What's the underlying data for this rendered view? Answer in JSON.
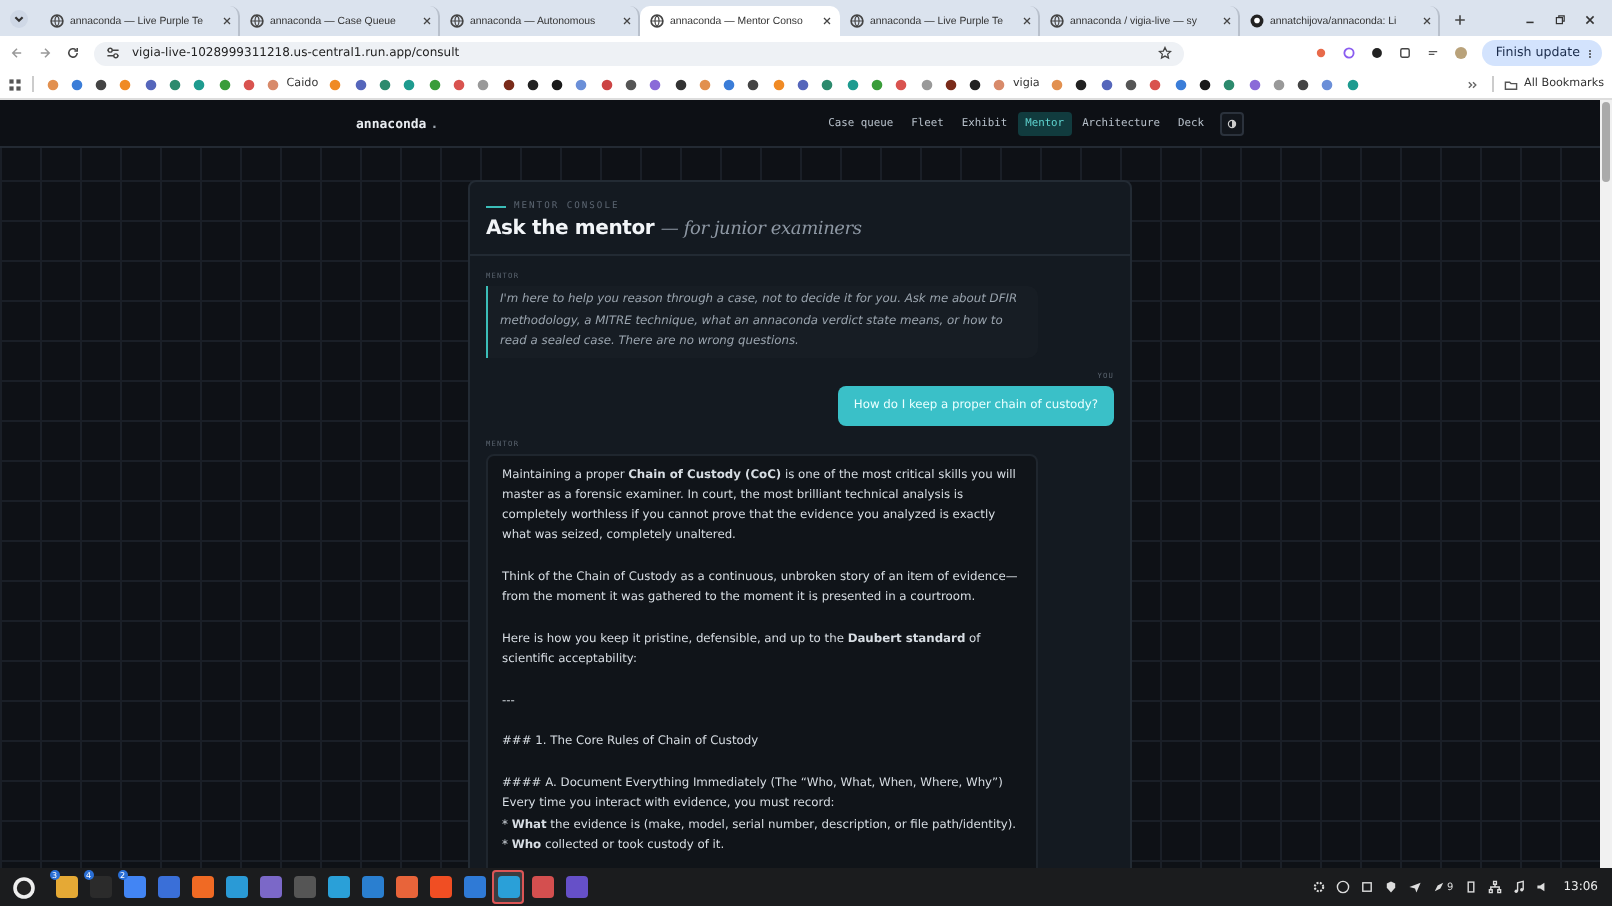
{
  "browser": {
    "tabs": [
      {
        "title": "annaconda — Live Purple Te",
        "kind": "globe",
        "selected": false
      },
      {
        "title": "annaconda — Case Queue",
        "kind": "globe",
        "selected": false
      },
      {
        "title": "annaconda — Autonomous",
        "kind": "globe",
        "selected": false
      },
      {
        "title": "annaconda — Mentor Conso",
        "kind": "globe",
        "selected": true
      },
      {
        "title": "annaconda — Live Purple Te",
        "kind": "globe",
        "selected": false
      },
      {
        "title": "annaconda / vigia-live — sy",
        "kind": "globe",
        "selected": false
      },
      {
        "title": "annatchijova/annaconda: Li",
        "kind": "github",
        "selected": false
      }
    ],
    "url": "vigia-live-1028999311218.us-central1.run.app/consult",
    "update_button": "Finish update",
    "bookmarks": [
      {
        "label": "Caido"
      },
      {
        "label": "vigia"
      }
    ],
    "all_bookmarks": "All Bookmarks"
  },
  "app": {
    "brand": "annaconda",
    "brand_mark": ".",
    "nav": [
      {
        "label": "Case queue",
        "selected": false
      },
      {
        "label": "Fleet",
        "selected": false
      },
      {
        "label": "Exhibit",
        "selected": false
      },
      {
        "label": "Mentor",
        "selected": true
      },
      {
        "label": "Architecture",
        "selected": false
      },
      {
        "label": "Deck",
        "selected": false
      }
    ],
    "console": {
      "eyebrow": "MENTOR CONSOLE",
      "title": "Ask the mentor",
      "subtitle": "— for junior examiners",
      "messages": [
        {
          "kind": "intro",
          "author": "MENTOR",
          "paragraphs": [
            "I'm here to help you reason through a case, not to decide it for you. Ask me about DFIR methodology, a MITRE technique, what an annaconda verdict state means, or how to read a sealed case. There are no wrong questions."
          ]
        },
        {
          "kind": "user",
          "author": "YOU",
          "paragraphs": [
            "How do I keep a proper chain of custody?"
          ]
        },
        {
          "kind": "mentor",
          "author": "MENTOR",
          "paragraphs": [
            "Maintaining a proper **Chain of Custody (CoC)** is one of the most critical skills you will master as a forensic examiner. In court, the most brilliant technical analysis is completely worthless if you cannot prove that the evidence you analyzed is exactly what was seized, completely unaltered.",
            "Think of the Chain of Custody as a continuous, unbroken story of an item of evidence—from the moment it was gathered to the moment it is presented in a courtroom.",
            "Here is how you keep it pristine, defensible, and up to the **Daubert standard** of scientific acceptability:",
            "---",
            "### 1. The Core Rules of Chain of Custody",
            "#### A. Document Everything Immediately (The “Who, What, When, Where, Why”)\nEvery time you interact with evidence, you must record:\n*   **What** the evidence is (make, model, serial number, description, or file path/identity).\n*   **Who** collected or took custody of it."
          ]
        }
      ]
    }
  },
  "taskbar": {
    "apps": [
      {
        "badge": "3",
        "selected": false
      },
      {
        "badge": "4",
        "selected": false
      },
      {
        "badge": "2",
        "selected": false
      },
      {
        "selected": false
      },
      {
        "selected": false
      },
      {
        "selected": false
      },
      {
        "selected": false
      },
      {
        "selected": false
      },
      {
        "selected": false
      },
      {
        "selected": false
      },
      {
        "selected": false
      },
      {
        "selected": false
      },
      {
        "selected": false
      },
      {
        "selected": true
      },
      {
        "selected": false
      },
      {
        "selected": false
      }
    ],
    "tray_badge": "9",
    "time": "13:06"
  }
}
